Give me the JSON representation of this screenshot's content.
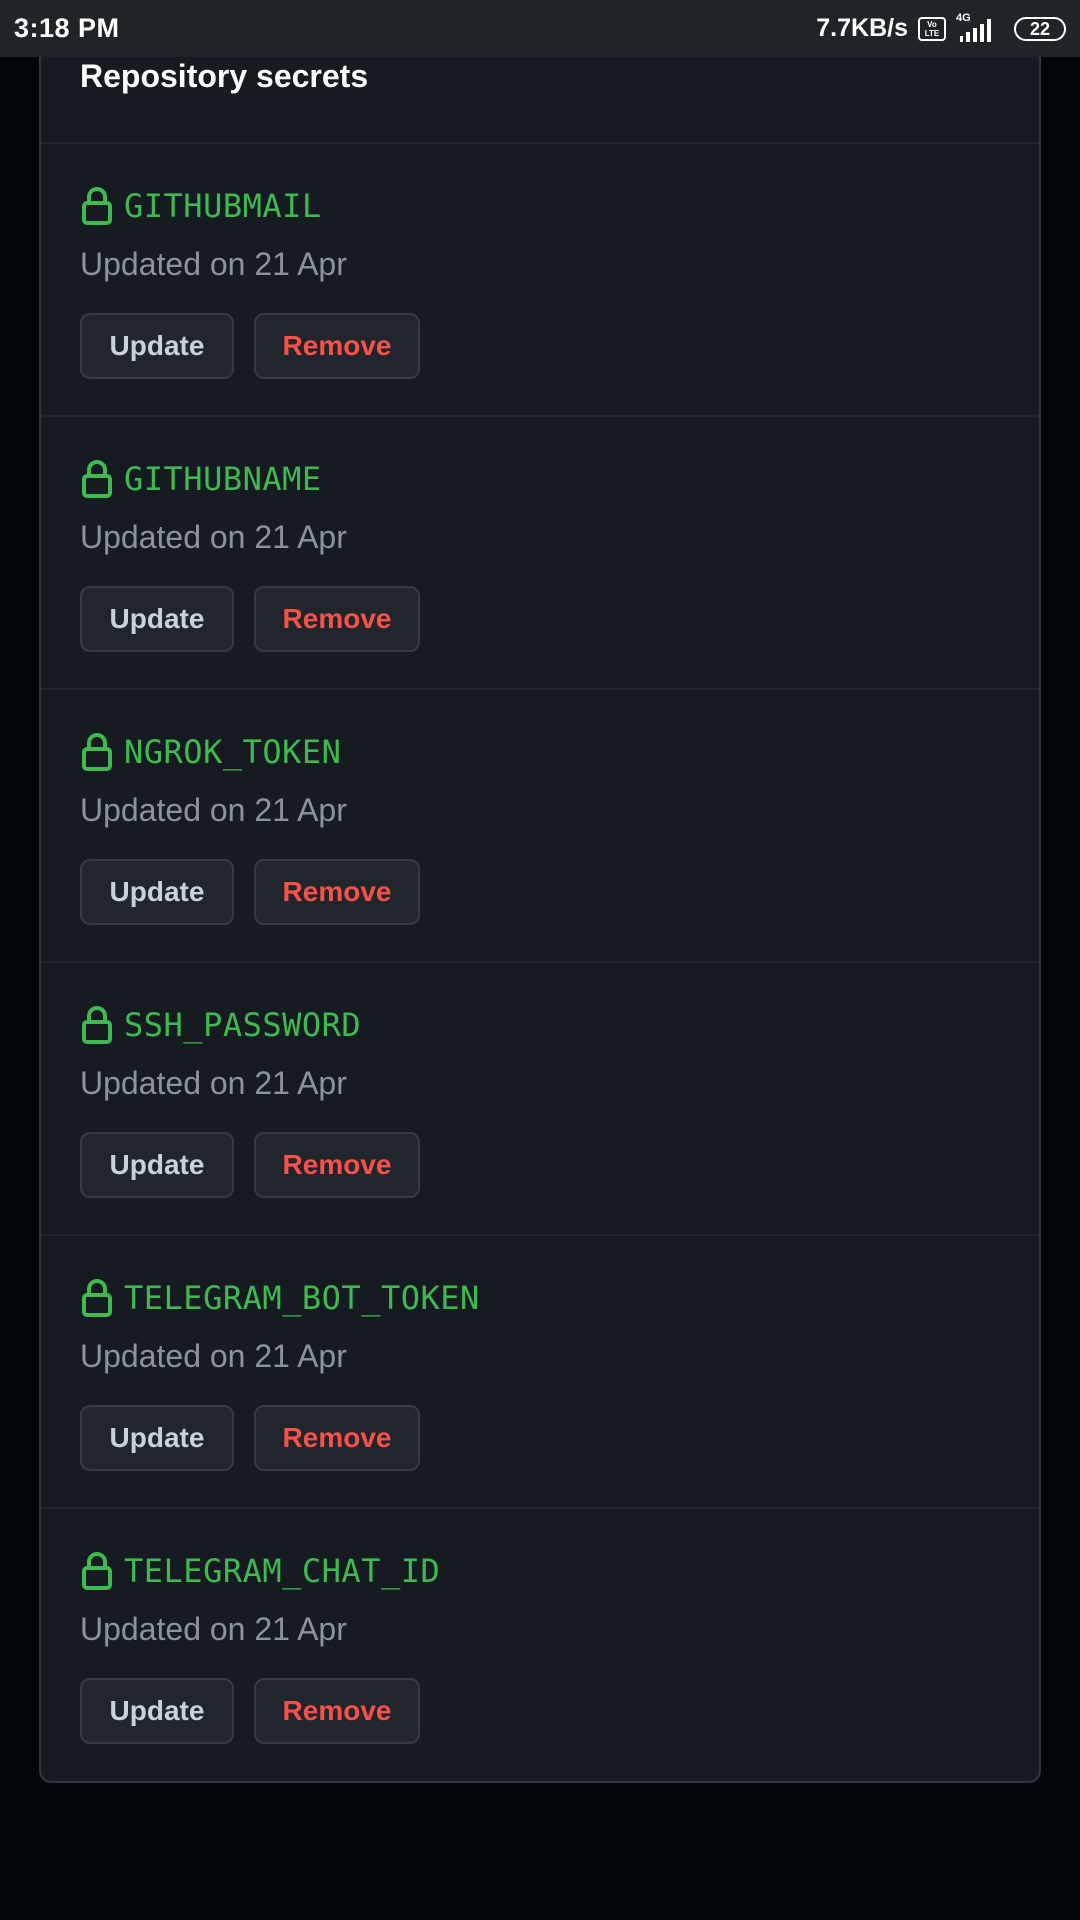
{
  "status_bar": {
    "time": "3:18 PM",
    "net_speed": "7.7KB/s",
    "volte_label": "Vo LTE",
    "network_type": "4G",
    "battery": "22"
  },
  "card": {
    "title": "Repository secrets",
    "update_label": "Update",
    "remove_label": "Remove",
    "secrets": [
      {
        "name": "GITHUBMAIL",
        "updated": "Updated on 21 Apr"
      },
      {
        "name": "GITHUBNAME",
        "updated": "Updated on 21 Apr"
      },
      {
        "name": "NGROK_TOKEN",
        "updated": "Updated on 21 Apr"
      },
      {
        "name": "SSH_PASSWORD",
        "updated": "Updated on 21 Apr"
      },
      {
        "name": "TELEGRAM_BOT_TOKEN",
        "updated": "Updated on 21 Apr"
      },
      {
        "name": "TELEGRAM_CHAT_ID",
        "updated": "Updated on 21 Apr"
      }
    ]
  },
  "icons": {
    "secret_icon": "lock-icon"
  },
  "colors": {
    "secret_name": "#3fb950",
    "remove_text": "#f85149",
    "card_bg": "#161b22",
    "page_bg": "#010409"
  }
}
